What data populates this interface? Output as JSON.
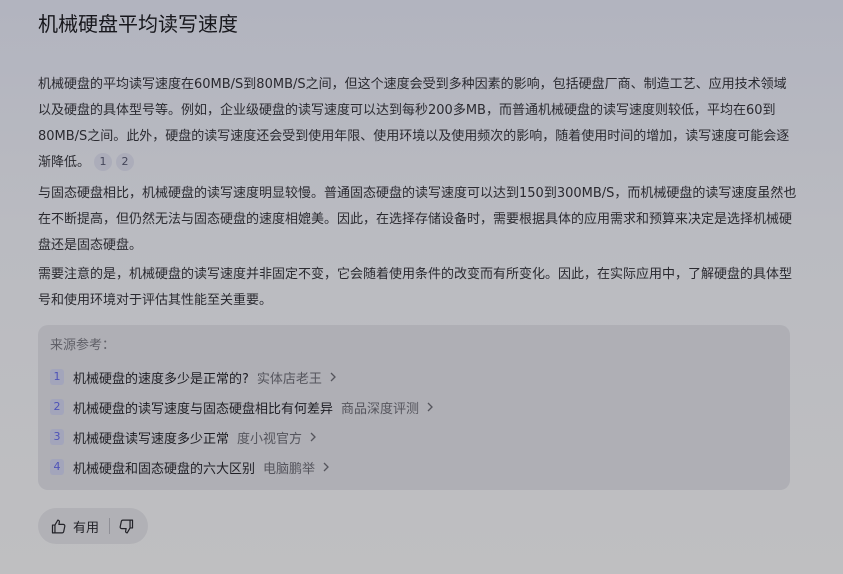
{
  "header": {
    "title": "机械硬盘平均读写速度"
  },
  "answer": {
    "paragraph1": "机械硬盘的平均读写速度在60MB/S到80MB/S之间，但这个速度会受到多种因素的影响，包括硬盘厂商、制造工艺、应用技术领域以及硬盘的具体型号等。例如，企业级硬盘的读写速度可以达到每秒200多MB，而普通机械硬盘的读写速度则较低，平均在60到80MB/S之间。此外，硬盘的读写速度还会受到使用年限、使用环境以及使用频次的影响，随着使用时间的增加，读写速度可能会逐渐降低。",
    "paragraph1_citations": [
      "1",
      "2"
    ],
    "paragraph2": "与固态硬盘相比，机械硬盘的读写速度明显较慢。普通固态硬盘的读写速度可以达到150到300MB/S，而机械硬盘的读写速度虽然也在不断提高，但仍然无法与固态硬盘的速度相媲美。因此，在选择存储设备时，需要根据具体的应用需求和预算来决定是选择机械硬盘还是固态硬盘。",
    "paragraph3": "需要注意的是，机械硬盘的读写速度并非固定不变，它会随着使用条件的改变而有所变化。因此，在实际应用中，了解硬盘的具体型号和使用环境对于评估其性能至关重要。"
  },
  "sources": {
    "label": "来源参考：",
    "items": [
      {
        "num": "1",
        "title": "机械硬盘的速度多少是正常的?",
        "site": "实体店老王"
      },
      {
        "num": "2",
        "title": "机械硬盘的读写速度与固态硬盘相比有何差异",
        "site": "商品深度评测"
      },
      {
        "num": "3",
        "title": "机械硬盘读写速度多少正常",
        "site": "度小视官方"
      },
      {
        "num": "4",
        "title": "机械硬盘和固态硬盘的六大区别",
        "site": "电脑鹏举"
      }
    ]
  },
  "feedback": {
    "like_label": "有用"
  },
  "colors": {
    "accent": "#4d52b8",
    "background": "#bcbdc3",
    "card": "#afafb5"
  },
  "icons": {
    "source_chevron": "chevron-right-icon",
    "like": "thumbs-up-icon",
    "dislike": "thumbs-down-icon"
  }
}
